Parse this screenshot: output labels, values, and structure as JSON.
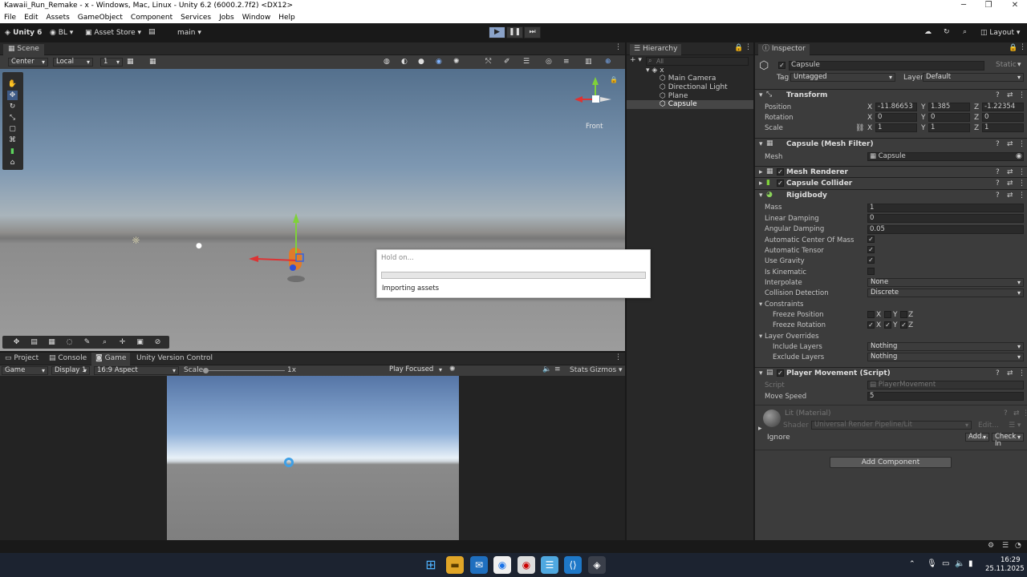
{
  "window": {
    "title": "Kawaii_Run_Remake - x - Windows, Mac, Linux - Unity 6.2 (6000.2.7f2) <DX12>",
    "minimize": "─",
    "maximize": "❐",
    "close": "✕"
  },
  "menu": [
    "File",
    "Edit",
    "Assets",
    "GameObject",
    "Component",
    "Services",
    "Jobs",
    "Window",
    "Help"
  ],
  "toolbar": {
    "unity": "Unity 6",
    "account": "BL",
    "asset_store": "Asset Store",
    "branch": "main",
    "layout": "Layout",
    "play": "▶",
    "pause": "❚❚",
    "step": "⏭"
  },
  "scene": {
    "tab": "Scene",
    "pivot": "Center",
    "space": "Local",
    "snap": "1",
    "orientation": "Front"
  },
  "bottom": {
    "tabs": [
      "Project",
      "Console",
      "Game",
      "Unity Version Control"
    ]
  },
  "game": {
    "display_mode": "Game",
    "display": "Display 1",
    "aspect": "16:9 Aspect",
    "scale_label": "Scale",
    "scale_value": "1x",
    "play_mode": "Play Focused",
    "stats": "Stats",
    "gizmos": "Gizmos"
  },
  "hierarchy": {
    "tab": "Hierarchy",
    "search_placeholder": "All",
    "scene": "x",
    "items": [
      "Main Camera",
      "Directional Light",
      "Plane",
      "Capsule"
    ],
    "selected": "Capsule"
  },
  "inspector": {
    "tab": "Inspector",
    "object_name": "Capsule",
    "static_label": "Static",
    "tag_label": "Tag",
    "tag": "Untagged",
    "layer_label": "Layer",
    "layer": "Default",
    "transform": {
      "title": "Transform",
      "position": {
        "label": "Position",
        "x": "-11.86653",
        "y": "1.385",
        "z": "-1.22354"
      },
      "rotation": {
        "label": "Rotation",
        "x": "0",
        "y": "0",
        "z": "0"
      },
      "scale": {
        "label": "Scale",
        "x": "1",
        "y": "1",
        "z": "1"
      }
    },
    "mesh_filter": {
      "title": "Capsule (Mesh Filter)",
      "mesh_label": "Mesh",
      "mesh": "Capsule"
    },
    "mesh_renderer": {
      "title": "Mesh Renderer"
    },
    "capsule_collider": {
      "title": "Capsule Collider"
    },
    "rigidbody": {
      "title": "Rigidbody",
      "mass": {
        "label": "Mass",
        "value": "1"
      },
      "linear_damping": {
        "label": "Linear Damping",
        "value": "0"
      },
      "angular_damping": {
        "label": "Angular Damping",
        "value": "0.05"
      },
      "auto_com": "Automatic Center Of Mass",
      "auto_tensor": "Automatic Tensor",
      "use_gravity": "Use Gravity",
      "is_kinematic": "Is Kinematic",
      "interpolate": {
        "label": "Interpolate",
        "value": "None"
      },
      "collision": {
        "label": "Collision Detection",
        "value": "Discrete"
      },
      "constraints": "Constraints",
      "freeze_pos": "Freeze Position",
      "freeze_rot": "Freeze Rotation",
      "layer_overrides": "Layer Overrides",
      "include": {
        "label": "Include Layers",
        "value": "Nothing"
      },
      "exclude": {
        "label": "Exclude Layers",
        "value": "Nothing"
      }
    },
    "script": {
      "title": "Player Movement (Script)",
      "script_label": "Script",
      "script": "PlayerMovement",
      "speed_label": "Move Speed",
      "speed": "5"
    },
    "material": {
      "name": "Lit (Material)",
      "shader_label": "Shader",
      "shader": "Universal Render Pipeline/Lit",
      "edit": "Edit...",
      "ignore": "Ignore",
      "add": "Add...",
      "checkin": "Check In"
    },
    "add_component": "Add Component"
  },
  "dialog": {
    "title": "Hold on...",
    "message": "Importing assets"
  },
  "taskbar": {
    "time": "16:29",
    "date": "25.11.2025"
  }
}
